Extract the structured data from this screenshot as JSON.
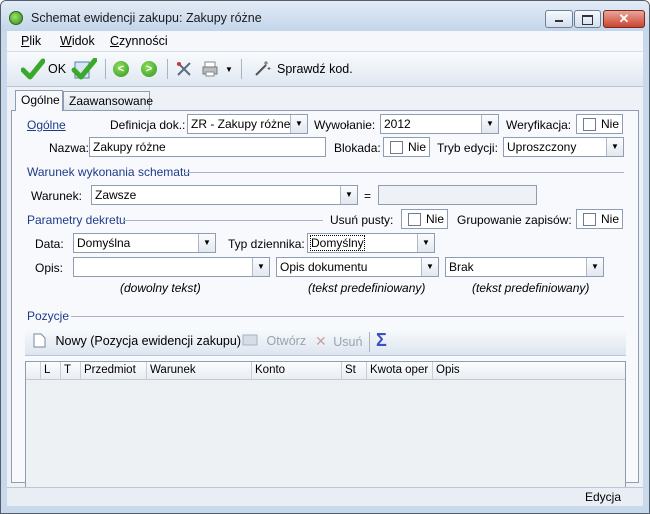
{
  "window": {
    "title": "Schemat ewidencji zakupu: Zakupy różne",
    "close_glyph": "✕"
  },
  "menu": [
    {
      "key": "P",
      "rest": "lik"
    },
    {
      "key": "W",
      "rest": "idok"
    },
    {
      "key": "C",
      "rest": "zynności"
    }
  ],
  "toolbar": {
    "ok_label": "OK",
    "check_label": "Sprawdź kod."
  },
  "tabs": [
    "Ogólne",
    "Zaawansowane"
  ],
  "general": {
    "section_title": "Ogólne",
    "definition_label": "Definicja dok.:",
    "definition_value": "ZR - Zakupy różne",
    "call_label": "Wywołanie:",
    "call_value": "2012",
    "verification_label": "Weryfikacja:",
    "verification_value": "Nie",
    "name_label": "Nazwa:",
    "name_value": "Zakupy różne",
    "lock_label": "Blokada:",
    "lock_value": "Nie",
    "edit_mode_label": "Tryb edycji:",
    "edit_mode_value": "Uproszczony"
  },
  "condition": {
    "section_title": "Warunek wykonania schematu",
    "label": "Warunek:",
    "value": "Zawsze",
    "equals": "=",
    "result_value": ""
  },
  "decree": {
    "section_title": "Parametry dekretu",
    "remove_empty_label": "Usuń pusty:",
    "remove_empty_value": "Nie",
    "group_label": "Grupowanie zapisów:",
    "group_value": "Nie",
    "date_label": "Data:",
    "date_value": "Domyślna",
    "journal_label": "Typ dziennika:",
    "journal_value": "Domyślny",
    "desc_label": "Opis:",
    "desc_value1": "",
    "desc_value2": "Opis dokumentu",
    "desc_value3": "Brak",
    "hint1": "(dowolny tekst)",
    "hint2": "(tekst predefiniowany)",
    "hint3": "(tekst predefiniowany)"
  },
  "positions": {
    "section_title": "Pozycje",
    "new_label": "Nowy (Pozycja ewidencji zakupu)",
    "open_label": "Otwórz",
    "delete_label": "Usuń",
    "columns": [
      "L",
      "T",
      "Przedmiot",
      "Warunek",
      "Konto",
      "St",
      "Kwota oper",
      "Opis"
    ]
  },
  "status": {
    "mode": "Edycja"
  },
  "icons": {
    "app": "app-icon",
    "ok": "ok-checkmark-icon",
    "back": "back-arrow-icon",
    "forward": "forward-arrow-icon",
    "tools": "tools-icon",
    "print": "printer-icon",
    "wand": "magic-wand-icon",
    "new": "new-document-icon",
    "open": "open-folder-icon",
    "delete": "delete-x-icon",
    "sum": "sigma-icon"
  },
  "colors": {
    "accent": "#1f3a8a",
    "ok_green": "#2f9320",
    "frame": "#c9d9ec"
  }
}
